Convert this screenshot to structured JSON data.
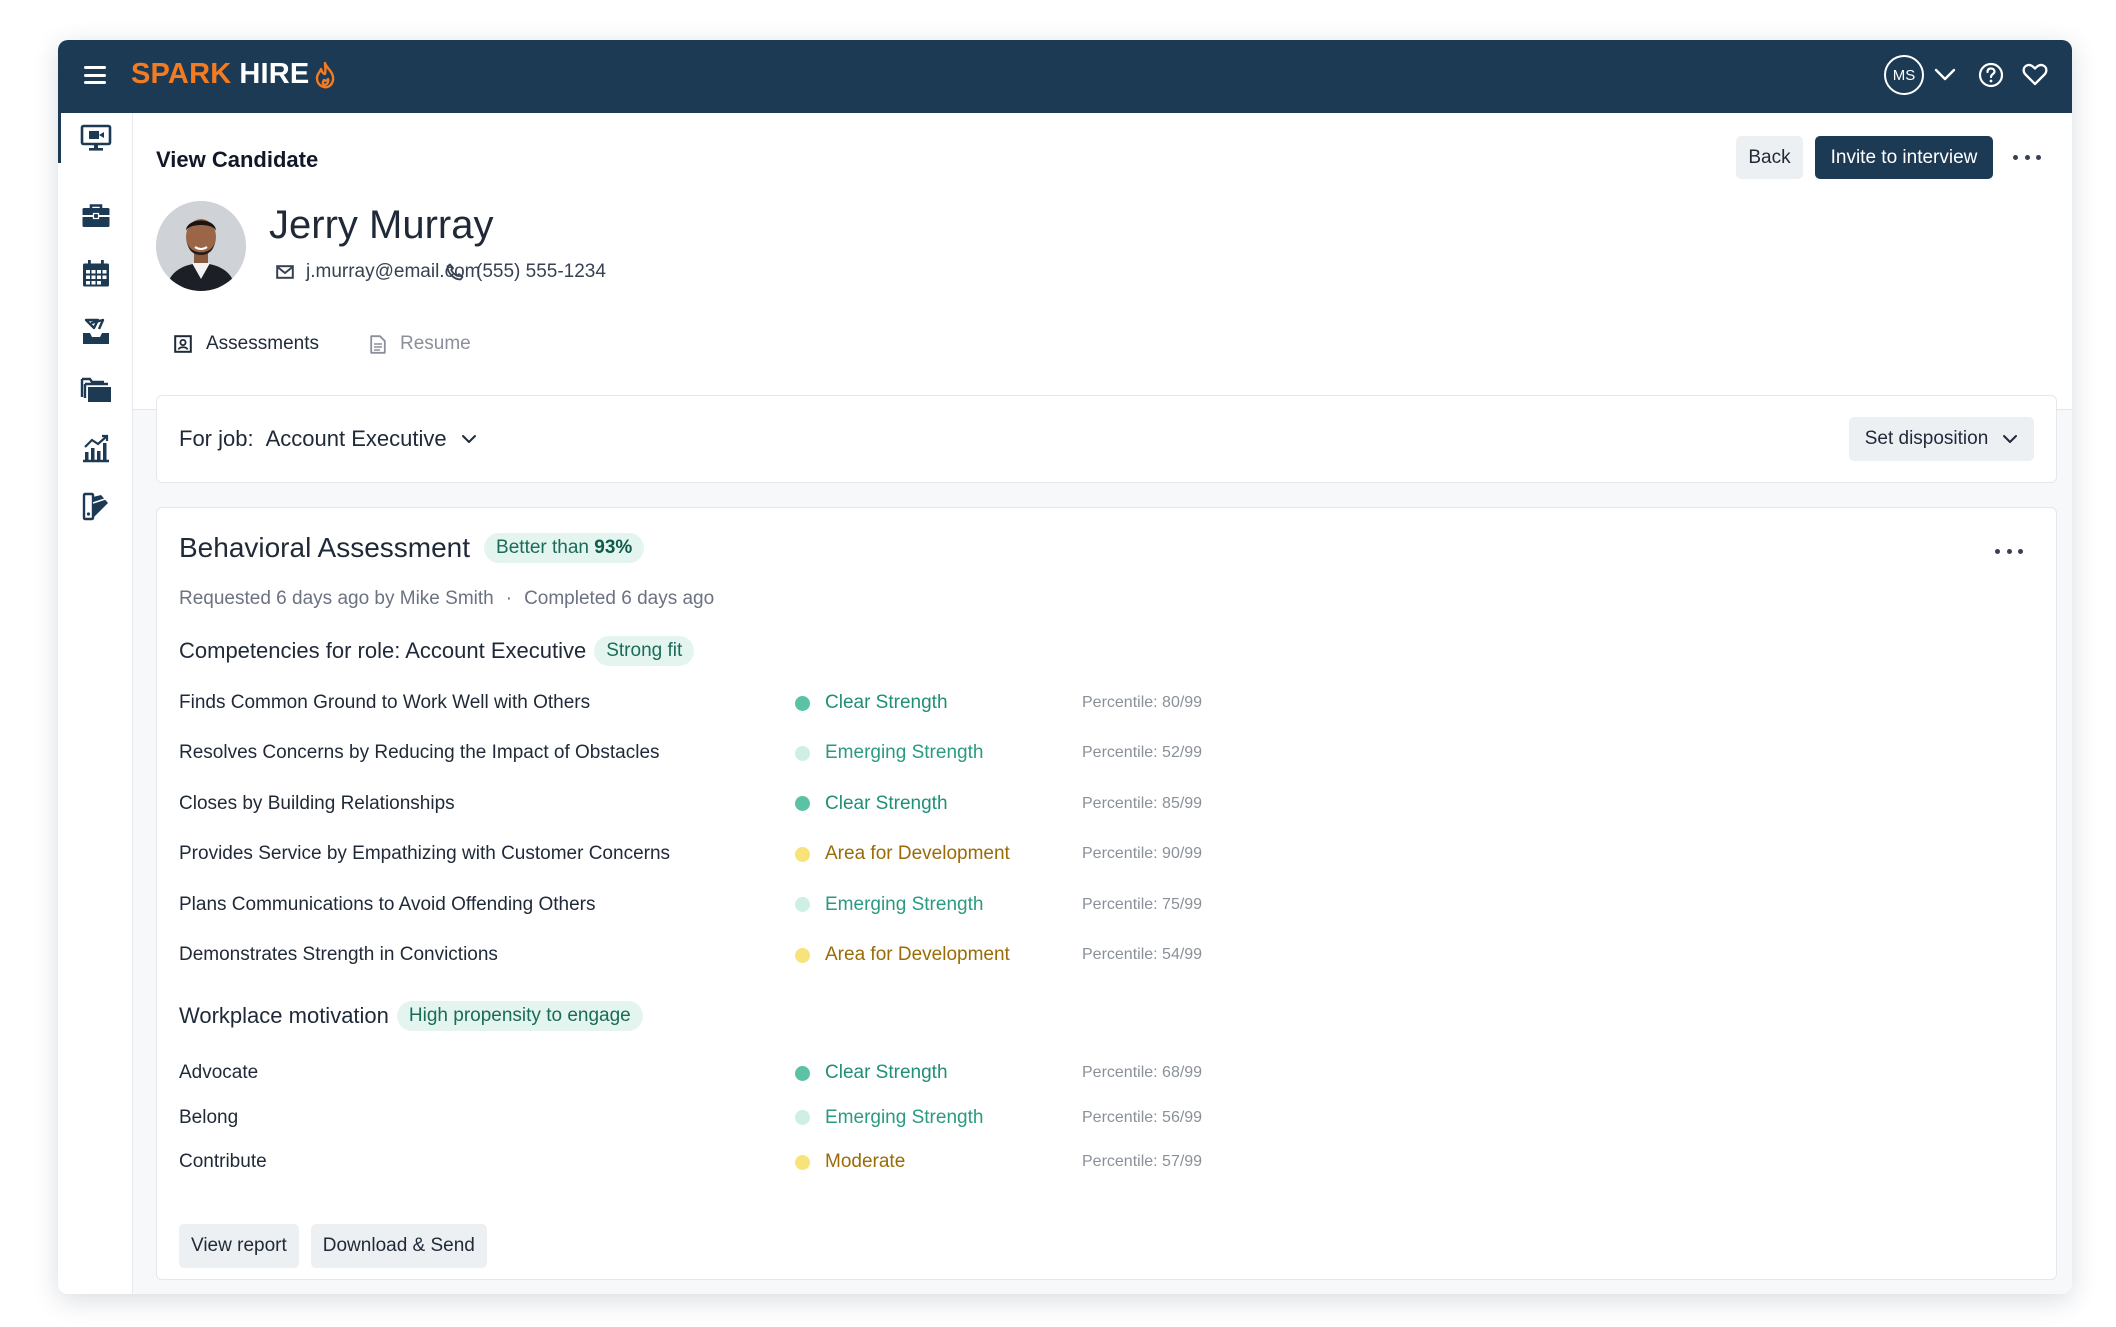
{
  "brand": {
    "name_part1": "SPARK",
    "name_part2": "HIRE",
    "accent": "#f47b20",
    "navy": "#1d3a55"
  },
  "header": {
    "user_initials": "MS"
  },
  "sidebar": {
    "items": [
      {
        "icon": "monitor-icon",
        "active": true
      },
      {
        "icon": "briefcase-icon"
      },
      {
        "icon": "calendar-icon"
      },
      {
        "icon": "inbox-icon"
      },
      {
        "icon": "folders-icon"
      },
      {
        "icon": "analytics-icon"
      },
      {
        "icon": "swatches-icon"
      }
    ]
  },
  "page": {
    "title": "View Candidate",
    "back_label": "Back",
    "invite_label": "Invite to interview"
  },
  "candidate": {
    "name": "Jerry Murray",
    "email": "j.murray@email.com",
    "phone": "(555) 555-1234"
  },
  "tabs": [
    {
      "label": "Assessments",
      "active": true
    },
    {
      "label": "Resume",
      "active": false
    }
  ],
  "job": {
    "prefix": "For job:",
    "name": "Account Executive",
    "disposition_label": "Set disposition"
  },
  "assessment": {
    "title": "Behavioral Assessment",
    "badge_prefix": "Better than",
    "badge_value": "93%",
    "requested": "Requested 6 days ago by Mike Smith",
    "separator": "·",
    "completed": "Completed 6 days ago",
    "competencies": {
      "heading": "Competencies for role: Account Executive",
      "badge": "Strong fit",
      "rows": [
        {
          "name": "Finds Common Ground to Work Well with Others",
          "status": "Clear Strength",
          "level": "clear",
          "percentile": "Percentile: 80/99"
        },
        {
          "name": "Resolves Concerns by Reducing the Impact of Obstacles",
          "status": "Emerging Strength",
          "level": "emerging",
          "percentile": "Percentile: 52/99"
        },
        {
          "name": "Closes by Building Relationships",
          "status": "Clear Strength",
          "level": "clear",
          "percentile": "Percentile: 85/99"
        },
        {
          "name": "Provides Service by Empathizing with Customer Concerns",
          "status": "Area for Development",
          "level": "dev",
          "percentile": "Percentile: 90/99"
        },
        {
          "name": "Plans Communications to Avoid Offending Others",
          "status": "Emerging Strength",
          "level": "emerging",
          "percentile": "Percentile: 75/99"
        },
        {
          "name": "Demonstrates Strength in Convictions",
          "status": "Area for Development",
          "level": "dev",
          "percentile": "Percentile: 54/99"
        }
      ]
    },
    "motivation": {
      "heading": "Workplace motivation",
      "badge": "High propensity to engage",
      "rows": [
        {
          "name": "Advocate",
          "status": "Clear Strength",
          "level": "clear",
          "percentile": "Percentile: 68/99"
        },
        {
          "name": "Belong",
          "status": "Emerging Strength",
          "level": "emerging",
          "percentile": "Percentile: 56/99"
        },
        {
          "name": "Contribute",
          "status": "Moderate",
          "level": "dev",
          "percentile": "Percentile: 57/99"
        }
      ]
    },
    "view_report_label": "View report",
    "download_label": "Download & Send"
  },
  "status_colors": {
    "clear": {
      "dot": "#5cc2a6",
      "text": "#1f8f77"
    },
    "emerging": {
      "dot": "#cfeee4",
      "text": "#2a9b80"
    },
    "dev": {
      "dot": "#f8e27a",
      "text": "#9a6b06"
    }
  }
}
